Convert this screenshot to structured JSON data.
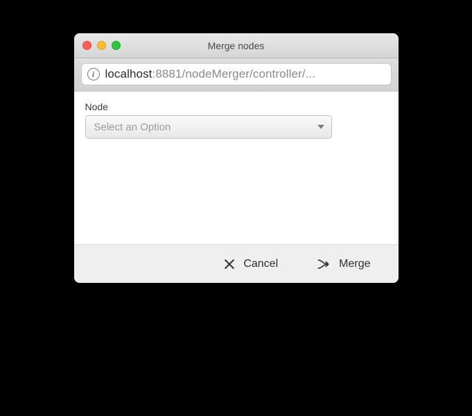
{
  "window": {
    "title": "Merge nodes"
  },
  "addressbar": {
    "host": "localhost",
    "rest": ":8881/nodeMerger/controller/...",
    "info_icon": "i"
  },
  "form": {
    "node_label": "Node",
    "node_placeholder": "Select an Option"
  },
  "footer": {
    "cancel_label": "Cancel",
    "merge_label": "Merge"
  }
}
